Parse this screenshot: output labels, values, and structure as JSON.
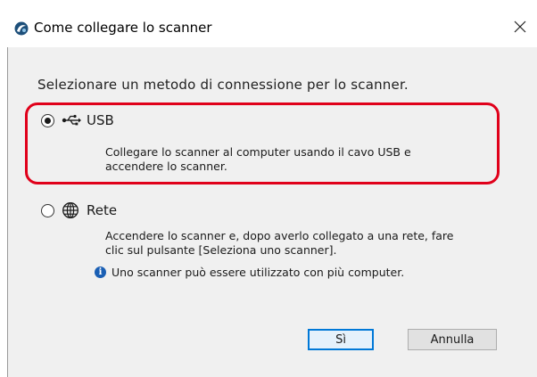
{
  "window": {
    "title": "Come collegare lo scanner",
    "close_glyph": "✕"
  },
  "instruction": "Selezionare un metodo di connessione per lo scanner.",
  "options": [
    {
      "label": "USB",
      "icon": "usb-icon",
      "selected": true,
      "description_lines": [
        "Collegare lo scanner al computer usando il cavo USB e",
        "accendere lo scanner."
      ]
    },
    {
      "label": "Rete",
      "icon": "globe-icon",
      "selected": false,
      "description_lines": [
        "Accendere lo scanner e, dopo averlo collegato a una rete, fare",
        "clic sul pulsante [Seleziona uno scanner]."
      ]
    }
  ],
  "info_note": "Uno scanner può essere utilizzato con più computer.",
  "info_glyph": "i",
  "buttons": {
    "ok_label": "Sì",
    "cancel_label": "Annulla"
  },
  "colors": {
    "highlight": "#e0001a",
    "primary_border": "#0078d7",
    "info_icon": "#1a5fb4"
  }
}
